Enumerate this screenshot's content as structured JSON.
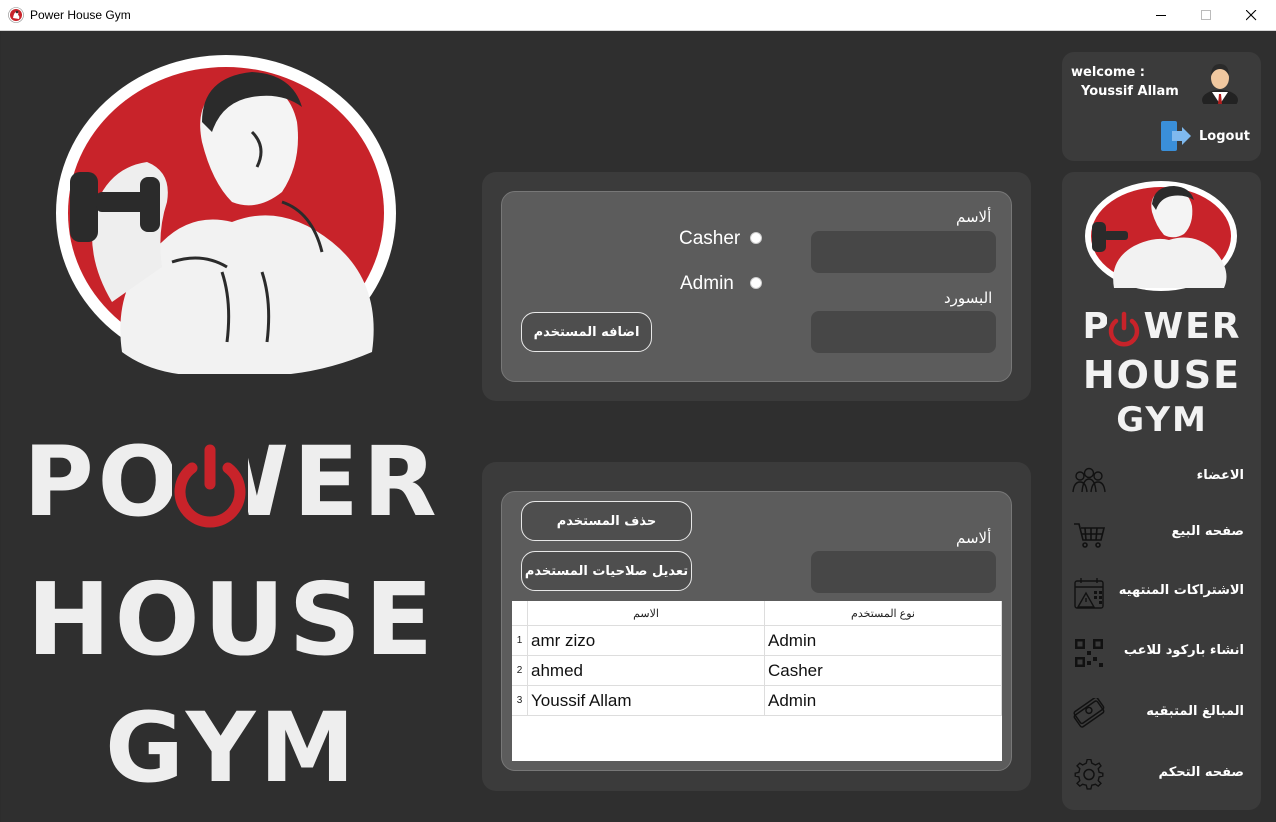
{
  "window": {
    "title": "Power House Gym"
  },
  "brand": {
    "line1": "POWER",
    "line2": "HOUSE",
    "line3": "GYM",
    "accent_color": "#c8232a"
  },
  "user_panel": {
    "welcome_label": "welcome :",
    "username": "Youssif Allam",
    "logout_label": "Logout"
  },
  "add_user_form": {
    "name_label": "ألاسم",
    "name_value": "",
    "password_label": "البسورد",
    "password_value": "",
    "role_options": [
      "Casher",
      "Admin"
    ],
    "add_button_label": "اضافه المستخدم"
  },
  "manage_user_form": {
    "name_label": "ألاسم",
    "name_value": "",
    "delete_button_label": "حذف المستخدم",
    "edit_permissions_button_label": "تعديل صلاحيات  المستخدم"
  },
  "users_table": {
    "columns": [
      "الاسم",
      "نوع المستخدم"
    ],
    "rows": [
      {
        "index": "1",
        "name": "amr zizo",
        "role": "Admin"
      },
      {
        "index": "2",
        "name": "ahmed",
        "role": "Casher"
      },
      {
        "index": "3",
        "name": "Youssif Allam",
        "role": "Admin"
      }
    ]
  },
  "sidebar": {
    "items": [
      {
        "label": "الاعضاء",
        "icon": "members-icon"
      },
      {
        "label": "صفحه البيع",
        "icon": "cart-icon"
      },
      {
        "label": "الاشتراكات المنتهيه",
        "icon": "expired-calendar-icon"
      },
      {
        "label": "انشاء باركود للاعب",
        "icon": "qr-code-icon"
      },
      {
        "label": "المبالغ المتبقيه",
        "icon": "money-icon"
      },
      {
        "label": "صفحه التحكم",
        "icon": "gear-icon"
      }
    ]
  }
}
